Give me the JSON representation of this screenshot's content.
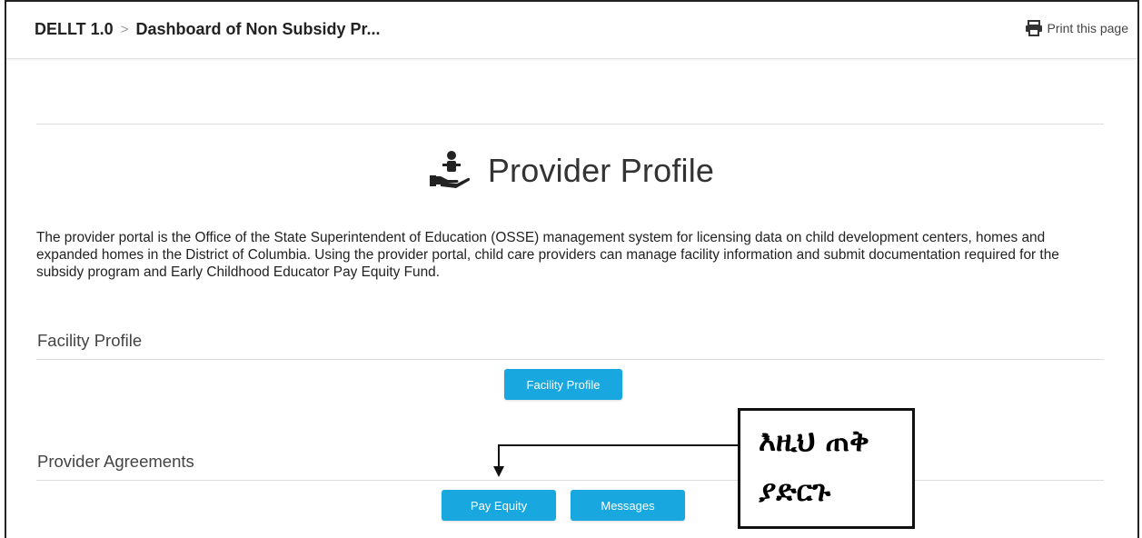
{
  "header": {
    "app_name": "DELLT 1.0",
    "separator": ">",
    "page_title": "Dashboard of Non Subsidy Pr...",
    "print_label": "Print this page"
  },
  "main": {
    "heading": "Provider Profile",
    "description": "The provider portal is the Office of the State Superintendent of Education (OSSE) management system for licensing data on child development centers, homes and expanded homes in the District of Columbia. Using the provider portal, child care providers can manage facility information and submit documentation required for the subsidy program and Early Childhood Educator Pay Equity Fund.",
    "sections": [
      {
        "title": "Facility Profile",
        "buttons": [
          "Facility Profile"
        ]
      },
      {
        "title": "Provider Agreements",
        "buttons": [
          "Pay Equity",
          "Messages"
        ]
      }
    ]
  },
  "annotation": {
    "text": "እዚህ ጠቅ\nያድርጉ"
  },
  "colors": {
    "button": "#19a7e0",
    "text": "#333333",
    "divider": "#dcdcdc"
  },
  "icons": [
    "print-icon",
    "provider-profile-icon",
    "arrow-down-icon"
  ]
}
